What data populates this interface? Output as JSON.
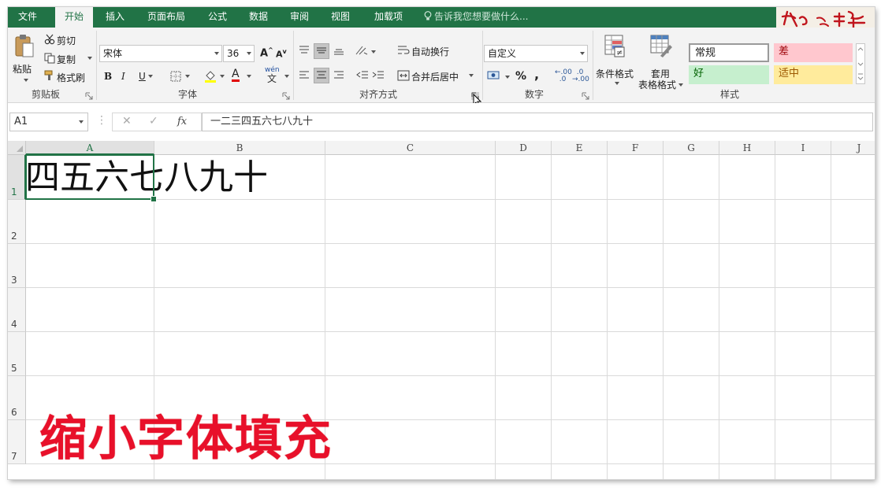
{
  "tabs": [
    "文件",
    "开始",
    "插入",
    "页面布局",
    "公式",
    "数据",
    "审阅",
    "视图",
    "加载项"
  ],
  "tell_me": "告诉我您想要做什么...",
  "clipboard": {
    "paste": "粘贴",
    "cut": "剪切",
    "copy": "复制",
    "format_painter": "格式刷",
    "label": "剪贴板"
  },
  "font": {
    "name": "宋体",
    "size": "36",
    "bold": "B",
    "italic": "I",
    "underline": "U",
    "grow": "A",
    "shrink": "A",
    "color_letter": "A",
    "phonetic_top": "wén",
    "phonetic_bottom": "文",
    "label": "字体"
  },
  "alignment": {
    "wrap": "自动换行",
    "merge": "合并后居中",
    "label": "对齐方式"
  },
  "number": {
    "format": "自定义",
    "percent": "%",
    "comma": ",",
    "inc_decimal": ".00",
    "dec_decimal": ".00",
    "label": "数字"
  },
  "styles": {
    "conditional": "条件格式",
    "table_line1": "套用",
    "table_line2": "表格格式",
    "normal": "常规",
    "bad": "差",
    "good": "好",
    "neutral": "适中",
    "label": "样式"
  },
  "formula_bar": {
    "name_box": "A1",
    "fx": "fx",
    "content": "一二三四五六七八九十"
  },
  "columns": [
    "A",
    "B",
    "C",
    "D",
    "E",
    "F",
    "G",
    "H",
    "I",
    "J"
  ],
  "rows": [
    "1",
    "2",
    "3",
    "4",
    "5",
    "6",
    "7"
  ],
  "cell_a1_visible": "四五六七八九十",
  "caption": "缩小字体填充",
  "colors": {
    "excel_green": "#217346",
    "bad_fill": "#ffc7ce",
    "bad_text": "#9c0006",
    "good_fill": "#c6efce",
    "good_text": "#006100",
    "neutral_fill": "#ffeb9c",
    "neutral_text": "#9c5700",
    "caption": "#e8102a"
  }
}
